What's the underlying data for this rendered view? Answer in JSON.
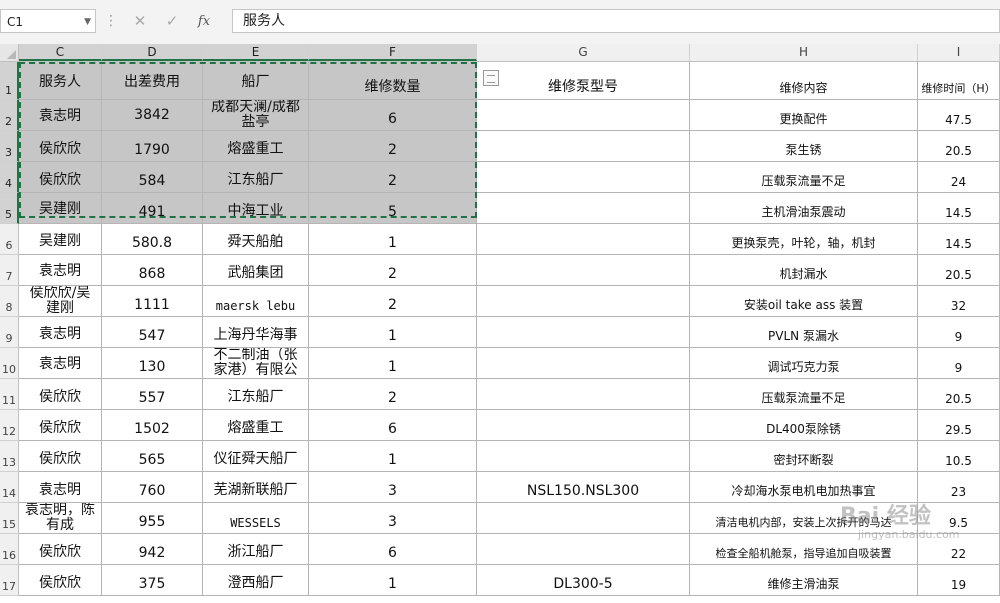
{
  "name_box": "C1",
  "formula_bar": {
    "fx_label": "fx",
    "cancel": "✕",
    "enter": "✓",
    "value": "服务人"
  },
  "columns": [
    "C",
    "D",
    "E",
    "F",
    "G",
    "H",
    "I"
  ],
  "rows": [
    "1",
    "2",
    "3",
    "4",
    "5",
    "6",
    "7",
    "8",
    "9",
    "10",
    "11",
    "12",
    "13",
    "14",
    "15",
    "16",
    "17"
  ],
  "headers": {
    "c": "服务人",
    "d": "出差费用",
    "e": "船厂",
    "f": "维修数量",
    "g": "维修泵型号",
    "h": "维修内容",
    "i": "维修时间（H）"
  },
  "data": [
    {
      "c": "袁志明",
      "d": "3842",
      "e": "成都天澜/成都\n盐亭",
      "f": "6",
      "g": "",
      "h": "更换配件",
      "i": "47.5"
    },
    {
      "c": "侯欣欣",
      "d": "1790",
      "e": "熔盛重工",
      "f": "2",
      "g": "",
      "h": "泵生锈",
      "i": "20.5"
    },
    {
      "c": "侯欣欣",
      "d": "584",
      "e": "江东船厂",
      "f": "2",
      "g": "",
      "h": "压载泵流量不足",
      "i": "24"
    },
    {
      "c": "吴建刚",
      "d": "491",
      "e": "中海工业",
      "f": "5",
      "g": "",
      "h": "主机滑油泵震动",
      "i": "14.5"
    },
    {
      "c": "吴建刚",
      "d": "580.8",
      "e": "舜天船舶",
      "f": "1",
      "g": "",
      "h": "更换泵壳，叶轮，轴，机封",
      "i": "14.5"
    },
    {
      "c": "袁志明",
      "d": "868",
      "e": "武船集团",
      "f": "2",
      "g": "",
      "h": "机封漏水",
      "i": "20.5"
    },
    {
      "c": "侯欣欣/吴\n建刚",
      "d": "1111",
      "e": "maersk lebu",
      "f": "2",
      "g": "",
      "h": "安装oil take ass 装置",
      "i": "32"
    },
    {
      "c": "袁志明",
      "d": "547",
      "e": "上海丹华海事",
      "f": "1",
      "g": "",
      "h": "PVLN 泵漏水",
      "i": "9"
    },
    {
      "c": "袁志明",
      "d": "130",
      "e": "不二制油（张\n家港）有限公",
      "f": "1",
      "g": "",
      "h": "调试巧克力泵",
      "i": "9"
    },
    {
      "c": "侯欣欣",
      "d": "557",
      "e": "江东船厂",
      "f": "2",
      "g": "",
      "h": "压载泵流量不足",
      "i": "20.5"
    },
    {
      "c": "侯欣欣",
      "d": "1502",
      "e": "熔盛重工",
      "f": "6",
      "g": "",
      "h": "DL400泵除锈",
      "i": "29.5"
    },
    {
      "c": "侯欣欣",
      "d": "565",
      "e": "仪征舜天船厂",
      "f": "1",
      "g": "",
      "h": "密封环断裂",
      "i": "10.5"
    },
    {
      "c": "袁志明",
      "d": "760",
      "e": "芜湖新联船厂",
      "f": "3",
      "g": "NSL150.NSL300",
      "h": "冷却海水泵电机电加热事宜",
      "i": "23"
    },
    {
      "c": "袁志明，陈\n有成",
      "d": "955",
      "e": "WESSELS",
      "f": "3",
      "g": "",
      "h": "清洁电机内部，安装上次拆开的马达",
      "i": "9.5"
    },
    {
      "c": "侯欣欣",
      "d": "942",
      "e": "浙江船厂",
      "f": "6",
      "g": "",
      "h": "检查全船机舱泵，指导追加自吸装置",
      "i": "22"
    },
    {
      "c": "侯欣欣",
      "d": "375",
      "e": "澄西船厂",
      "f": "1",
      "g": "DL300-5",
      "h": "维修主滑油泵",
      "i": "19"
    }
  ],
  "watermark": {
    "main": "Bai 经验",
    "sub": "jingyan.baidu.com"
  }
}
